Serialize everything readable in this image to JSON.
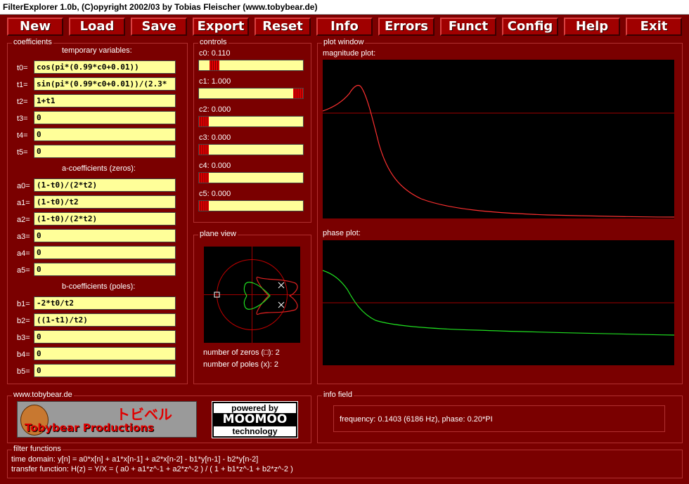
{
  "title": "FilterExplorer 1.0b, (C)opyright 2002/03 by Tobias Fleischer (www.tobybear.de)",
  "menu": [
    "New",
    "Load",
    "Save",
    "Export",
    "Reset",
    "Info",
    "Errors",
    "Funct",
    "Config",
    "Help",
    "Exit"
  ],
  "coefficients": {
    "group_label": "coefficients",
    "temp_heading": "temporary variables:",
    "temps": [
      {
        "label": "t0=",
        "value": "cos(pi*(0.99*c0+0.01))"
      },
      {
        "label": "t1=",
        "value": "sin(pi*(0.99*c0+0.01))/(2.3*"
      },
      {
        "label": "t2=",
        "value": "1+t1"
      },
      {
        "label": "t3=",
        "value": "0"
      },
      {
        "label": "t4=",
        "value": "0"
      },
      {
        "label": "t5=",
        "value": "0"
      }
    ],
    "a_heading": "a-coefficients (zeros):",
    "a": [
      {
        "label": "a0=",
        "value": "(1-t0)/(2*t2)"
      },
      {
        "label": "a1=",
        "value": "(1-t0)/t2"
      },
      {
        "label": "a2=",
        "value": "(1-t0)/(2*t2)"
      },
      {
        "label": "a3=",
        "value": "0"
      },
      {
        "label": "a4=",
        "value": "0"
      },
      {
        "label": "a5=",
        "value": "0"
      }
    ],
    "b_heading": "b-coefficients (poles):",
    "b": [
      {
        "label": "b1=",
        "value": "-2*t0/t2"
      },
      {
        "label": "b2=",
        "value": "((1-t1)/t2)"
      },
      {
        "label": "b3=",
        "value": "0"
      },
      {
        "label": "b4=",
        "value": "0"
      },
      {
        "label": "b5=",
        "value": "0"
      }
    ]
  },
  "controls": {
    "group_label": "controls",
    "sliders": [
      {
        "label": "c0: 0.110",
        "value": 0.11
      },
      {
        "label": "c1: 1.000",
        "value": 1.0
      },
      {
        "label": "c2: 0.000",
        "value": 0.0
      },
      {
        "label": "c3: 0.000",
        "value": 0.0
      },
      {
        "label": "c4: 0.000",
        "value": 0.0
      },
      {
        "label": "c5: 0.000",
        "value": 0.0
      }
    ]
  },
  "plane_view": {
    "group_label": "plane view",
    "zeros_text": "number of zeros (□): 2",
    "poles_text": "number of poles (x): 2"
  },
  "plot_window": {
    "group_label": "plot window",
    "magnitude_label": "magnitude plot:",
    "phase_label": "phase plot:",
    "magnitude_color": "#ff3030",
    "phase_color": "#20e020"
  },
  "website": {
    "group_label": "www.tobybear.de",
    "logo_japanese": "トビベル",
    "logo_text": "Tobybear Productions",
    "powered_1": "powered by",
    "powered_2": "MOOMOO",
    "powered_3": "technology"
  },
  "info_field": {
    "group_label": "info field",
    "text": "frequency: 0.1403 (6186 Hz), phase: 0.20*PI"
  },
  "filter_functions": {
    "group_label": "filter functions",
    "time_domain": "time domain: y[n] = a0*x[n] + a1*x[n-1] + a2*x[n-2]  - b1*y[n-1] - b2*y[n-2]",
    "transfer": "transfer function: H(z) = Y/X = ( a0 + a1*z^-1 + a2*z^-2  )  / ( 1 + b1*z^-1 + b2*z^-2  )"
  }
}
